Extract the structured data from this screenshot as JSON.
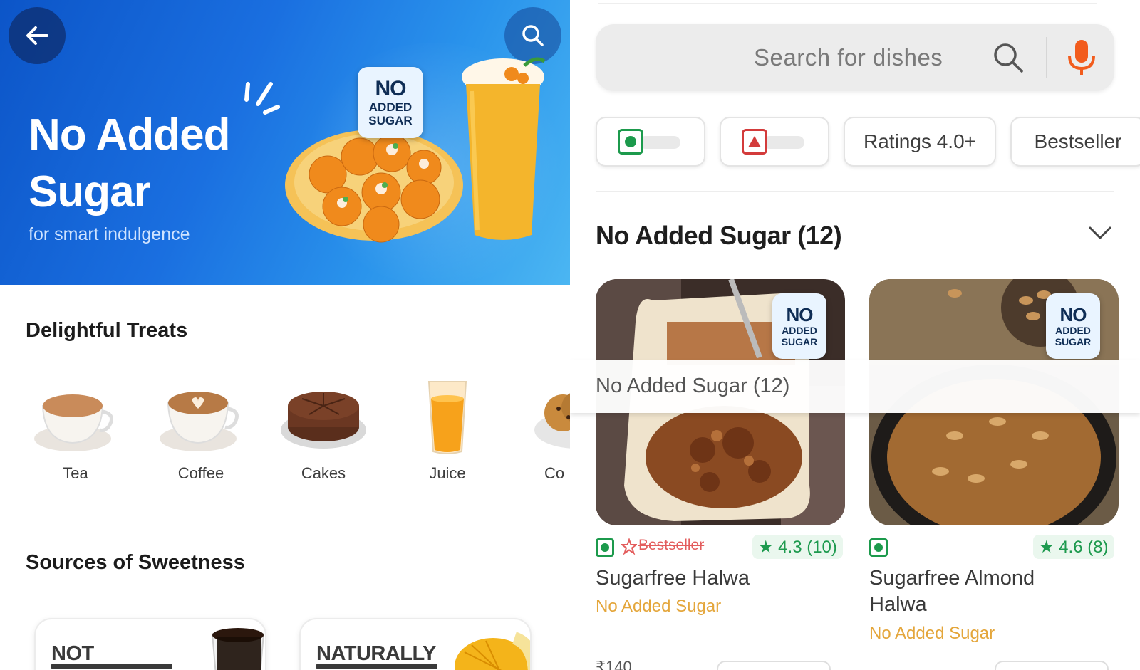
{
  "colors": {
    "banner_blue": "#1a6fe0",
    "veg_green": "#1c9a4c",
    "nonveg_red": "#d33b3b",
    "tag_orange": "#e4a63b",
    "rating_green": "#1d9a4e"
  },
  "left": {
    "banner": {
      "back_icon": "arrow-left-icon",
      "search_icon": "search-icon",
      "title": "No Added Sugar",
      "subtitle": "for smart indulgence",
      "badge": {
        "line1": "NO",
        "line2": "ADDED",
        "line3": "SUGAR"
      }
    },
    "treats_title": "Delightful Treats",
    "treats": [
      {
        "label": "Tea",
        "icon": "tea-cup"
      },
      {
        "label": "Coffee",
        "icon": "coffee-cup"
      },
      {
        "label": "Cakes",
        "icon": "cake"
      },
      {
        "label": "Juice",
        "icon": "juice-glass"
      },
      {
        "label": "Co",
        "icon": "cookies"
      }
    ],
    "sources_title": "Sources of Sweetness",
    "sources": [
      {
        "label": "NOT"
      },
      {
        "label": "NATURALLY"
      }
    ]
  },
  "right": {
    "search": {
      "placeholder": "Search for dishes",
      "search_icon": "search-icon",
      "mic_icon": "microphone-icon"
    },
    "filters": [
      {
        "type": "veg-toggle"
      },
      {
        "type": "nonveg-toggle"
      },
      {
        "label": "Ratings 4.0+"
      },
      {
        "label": "Bestseller"
      }
    ],
    "section": {
      "title": "No Added Sugar (12)",
      "sticky_title": "No Added Sugar (12)"
    },
    "dishes": [
      {
        "name_line1": "Sugarfree Halwa",
        "name_line2": "",
        "tag": "No Added Sugar",
        "bestseller": "Bestseller",
        "rating": "★ 4.3 (10)",
        "price": "₹140",
        "badge": {
          "line1": "NO",
          "line2": "ADDED",
          "line3": "SUGAR"
        }
      },
      {
        "name_line1": "Sugarfree Almond",
        "name_line2": "Halwa",
        "tag": "No Added Sugar",
        "bestseller": "",
        "rating": "★ 4.6 (8)",
        "price": "",
        "badge": {
          "line1": "NO",
          "line2": "ADDED",
          "line3": "SUGAR"
        }
      }
    ]
  }
}
